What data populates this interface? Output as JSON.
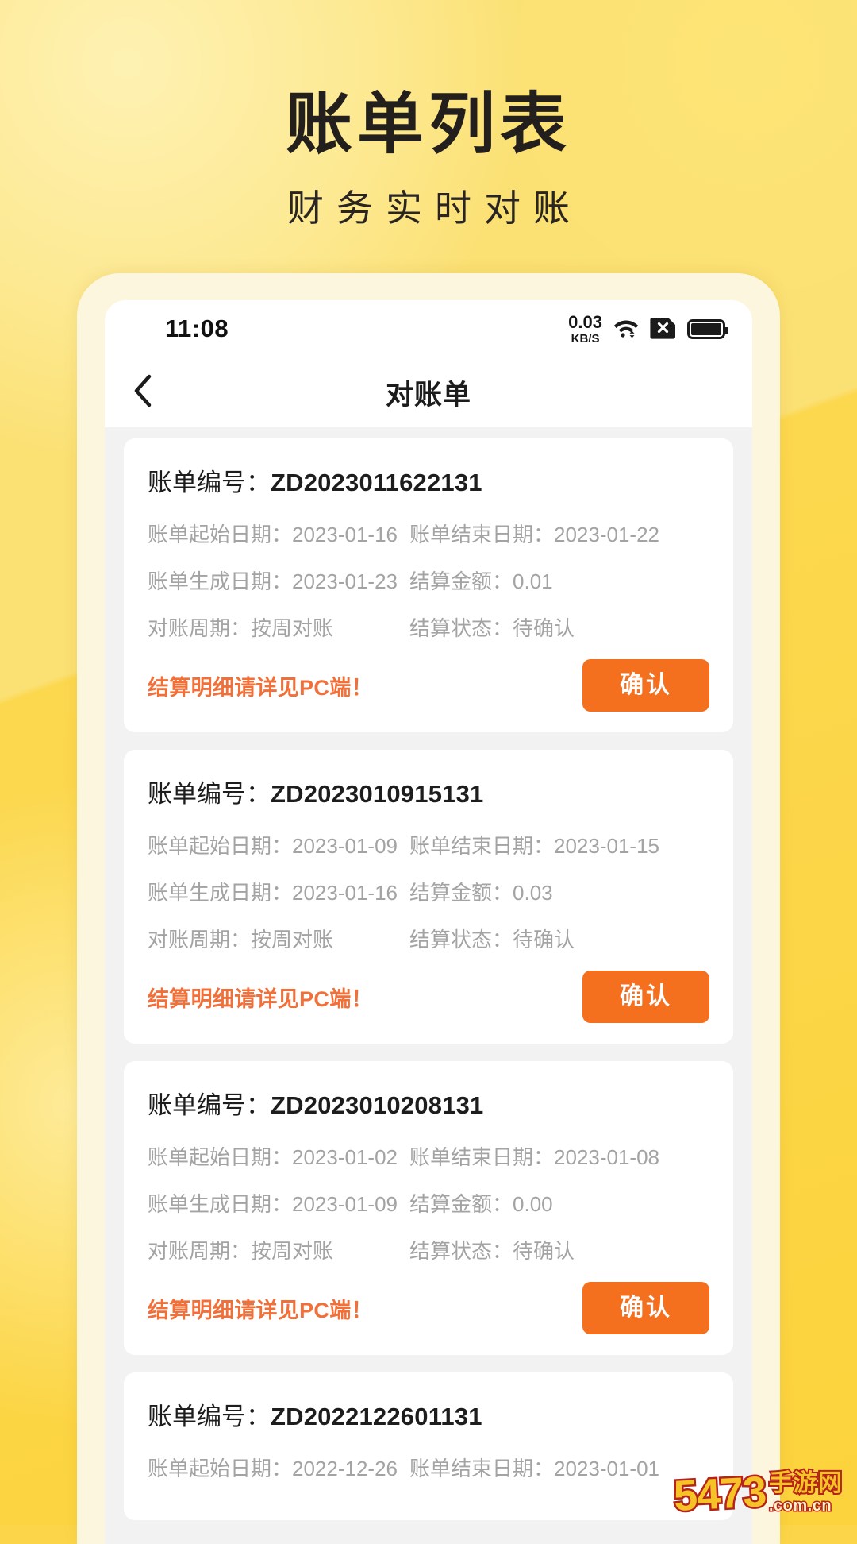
{
  "promo": {
    "title": "账单列表",
    "subtitle": "财务实时对账"
  },
  "status_bar": {
    "time": "11:08",
    "net_speed_value": "0.03",
    "net_speed_unit": "KB/S",
    "icons": [
      "wifi-icon",
      "sim-disabled-icon",
      "battery-icon"
    ]
  },
  "nav": {
    "back_icon": "chevron-left-icon",
    "title": "对账单"
  },
  "labels": {
    "bill_no": "账单编号：",
    "start_date": "账单起始日期：",
    "end_date": "账单结束日期：",
    "create_date": "账单生成日期：",
    "amount": "结算金额：",
    "cycle": "对账周期：",
    "status": "结算状态：",
    "note": "结算明细请详见PC端！",
    "confirm": "确认"
  },
  "colors": {
    "accent_orange": "#F4701F",
    "note_orange": "#F1703A",
    "bg_yellow": "#FCD33C",
    "card_white": "#FFFFFF"
  },
  "bills": [
    {
      "no": "ZD2023011622131",
      "start_date": "2023-01-16",
      "end_date": "2023-01-22",
      "create_date": "2023-01-23",
      "amount": "0.01",
      "cycle": "按周对账",
      "status": "待确认"
    },
    {
      "no": "ZD2023010915131",
      "start_date": "2023-01-09",
      "end_date": "2023-01-15",
      "create_date": "2023-01-16",
      "amount": "0.03",
      "cycle": "按周对账",
      "status": "待确认"
    },
    {
      "no": "ZD2023010208131",
      "start_date": "2023-01-02",
      "end_date": "2023-01-08",
      "create_date": "2023-01-09",
      "amount": "0.00",
      "cycle": "按周对账",
      "status": "待确认"
    },
    {
      "no": "ZD2022122601131",
      "start_date": "2022-12-26",
      "end_date": "2023-01-01",
      "create_date": "",
      "amount": "",
      "cycle": "",
      "status": ""
    }
  ],
  "watermark": {
    "number": "5473",
    "cn": "手游网",
    "domain": ".com.cn"
  }
}
